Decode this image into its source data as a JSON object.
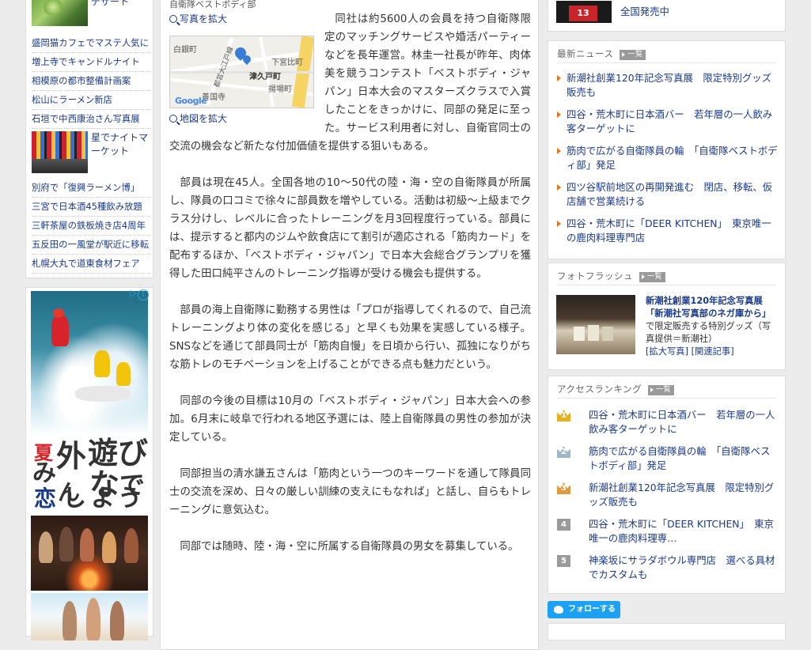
{
  "left_sidebar": {
    "top_thumb_caption": "デザート",
    "links_a": [
      "盛岡猫カフェでマステ人気に",
      "増上寺でキャンドルナイト",
      "相模原の都市整備計画案",
      "松山にラーメン新店",
      "石垣で中西康治さん写真展"
    ],
    "market_caption": "星でナイトマーケット",
    "links_b": [
      "別府で「復興ラーメン博」",
      "三宮で日本酒45種飲み放題",
      "三軒茶屋の鉄板焼き店4周年",
      "五反田の一風堂が駅近に移転",
      "札幌大丸で道東食材フェア"
    ]
  },
  "ad": {
    "text_chars": [
      "夏",
      "外",
      "遊",
      "び",
      "で",
      "み",
      "ん",
      "な",
      "恋",
      "し",
      "よ",
      "う"
    ],
    "info": "i"
  },
  "article": {
    "photo_caption": "自衛隊ベストボディ部",
    "photo_zoom": "写真を拡大",
    "map_zoom": "地図を拡大",
    "map_labels": {
      "a": "白銀町",
      "b": "下宮比町",
      "c": "津久戸町",
      "d": "揚場町",
      "e": "善国寺",
      "f": "都営大江戸線",
      "google": "Google"
    },
    "paragraphs": [
      "同社は約5600人の会員を持つ自衛隊限定のマッチングサービスや婚活パーティーなどを長年運営。林圭一社長が昨年、肉体美を競うコンテスト「ベストボディ・ジャパン」日本大会のマスターズクラスで入賞したことをきっかけに、同部の発足に至った。サービス利用者に対し、自衛官同士の交流の機会など新たな付加価値を提供する狙いもある。",
      "部員は現在45人。全国各地の10～50代の陸・海・空の自衛隊員が所属し、隊員の口コミで徐々に部員数を増やしている。活動は初級～上級までクラス分けし、レベルに合ったトレーニングを月3回程度行っている。部員には、提示すると都内のジムや飲食店にて割引が適応される「筋肉カード」を配布するほか、「ベストボディ・ジャパン」で日本大会総合グランプリを獲得した田口純平さんのトレーニング指導が受ける機会も提供する。",
      "部員の海上自衛隊に勤務する男性は「プロが指導してくれるので、自己流トレーニングより体の変化を感じる」と早くも効果を実感している様子。SNSなどを通じて部員同士が「筋肉自慢」を日頃から行い、孤独になりがちな筋トレのモチベーションを上げることができる点も魅力だという。",
      "同部の今後の目標は10月の「ベストボディ・ジャパン」日本大会への参加。6月末に岐阜で行われる地区予選には、陸上自衛隊員の男性の参加が決定している。",
      "同部担当の清水謙五さんは「筋肉という一つのキーワードを通して隊員同士の交流を深め、日々の厳しい訓練の支えにもなれば」と話し、自らもトレーニングに意気込む。",
      "同部では随時、陸・海・空に所属する自衛隊員の男女を募集している。"
    ]
  },
  "right": {
    "top_caption": "全国発売中",
    "top_badge": "13",
    "news": {
      "title": "最新ニュース",
      "more": "一覧",
      "items": [
        "新潮社創業120年記念写真展　限定特別グッズ販売も",
        "四谷・荒木町に日本酒バー　若年層の一人飲み客ターゲットに",
        "筋肉で広がる自衛隊員の輪　「自衛隊ベストボディ部」発足",
        "四ツ谷駅前地区の再開発進む　閉店、移転、仮店舗で営業続ける",
        "四谷・荒木町に「DEER KITCHEN」　東京唯一の鹿肉料理専門店"
      ]
    },
    "photo_flash": {
      "title": "フォトフラッシュ",
      "more": "一覧",
      "headline": "新潮社創業120年記念写真展",
      "subhead": "「新潮社写真部のネガ庫から」",
      "tail": "で限定販売する特別グッズ（写真提供＝新潮社）",
      "link1": "[拡大写真]",
      "link2": "[関連記事]"
    },
    "ranking": {
      "title": "アクセスランキング",
      "more": "一覧",
      "items": [
        {
          "rank": "1",
          "text": "四谷・荒木町に日本酒バー　若年層の一人飲み客ターゲットに",
          "color": "#e8b020"
        },
        {
          "rank": "2",
          "text": "筋肉で広がる自衛隊員の輪　「自衛隊ベストボディ部」発足",
          "color": "#9fb7c7"
        },
        {
          "rank": "3",
          "text": "新潮社創業120年記念写真展　限定特別グッズ販売も",
          "color": "#e09a3a"
        },
        {
          "rank": "4",
          "text": "四谷・荒木町に「DEER KITCHEN」　東京唯一の鹿肉料理専…",
          "color": "#9a9a9a"
        },
        {
          "rank": "5",
          "text": "神楽坂にサラダボウル専門店　選べる具材でカスタムも",
          "color": "#9a9a9a"
        }
      ]
    },
    "follow": "フォローする"
  }
}
